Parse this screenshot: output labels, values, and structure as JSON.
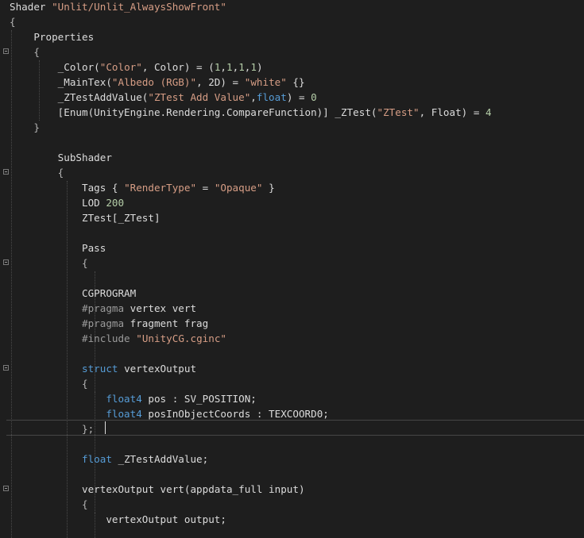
{
  "editor": {
    "theme_colors": {
      "background": "#1e1e1e",
      "default": "#dcdcdc",
      "string": "#d69d85",
      "keyword": "#569cd6",
      "number": "#b5cea8",
      "preprocessor": "#9b9b9b"
    },
    "lines": [
      [
        [
          "default",
          "Shader "
        ],
        [
          "string",
          "\"Unlit/Unlit_AlwaysShowFront\""
        ]
      ],
      [
        [
          "punct",
          "{"
        ]
      ],
      [
        [
          "default",
          "    Properties"
        ]
      ],
      [
        [
          "punct",
          "    {"
        ]
      ],
      [
        [
          "default",
          "        _Color("
        ],
        [
          "string",
          "\"Color\""
        ],
        [
          "default",
          ", Color) = ("
        ],
        [
          "number",
          "1"
        ],
        [
          "default",
          ","
        ],
        [
          "number",
          "1"
        ],
        [
          "default",
          ","
        ],
        [
          "number",
          "1"
        ],
        [
          "default",
          ","
        ],
        [
          "number",
          "1"
        ],
        [
          "default",
          ")"
        ]
      ],
      [
        [
          "default",
          "        _MainTex("
        ],
        [
          "string",
          "\"Albedo (RGB)\""
        ],
        [
          "default",
          ", 2D) = "
        ],
        [
          "string",
          "\"white\""
        ],
        [
          "default",
          " {}"
        ]
      ],
      [
        [
          "default",
          "        _ZTestAddValue("
        ],
        [
          "string",
          "\"ZTest Add Value\""
        ],
        [
          "default",
          ","
        ],
        [
          "keyword",
          "float"
        ],
        [
          "default",
          ") = "
        ],
        [
          "number",
          "0"
        ]
      ],
      [
        [
          "default",
          "        [Enum(UnityEngine.Rendering.CompareFunction)] _ZTest("
        ],
        [
          "string",
          "\"ZTest\""
        ],
        [
          "default",
          ", Float) = "
        ],
        [
          "number",
          "4"
        ]
      ],
      [
        [
          "punct",
          "    }"
        ]
      ],
      [
        [
          "default",
          ""
        ]
      ],
      [
        [
          "default",
          "        SubShader"
        ]
      ],
      [
        [
          "punct",
          "        {"
        ]
      ],
      [
        [
          "default",
          "            Tags { "
        ],
        [
          "string",
          "\"RenderType\""
        ],
        [
          "default",
          " = "
        ],
        [
          "string",
          "\"Opaque\""
        ],
        [
          "default",
          " }"
        ]
      ],
      [
        [
          "default",
          "            LOD "
        ],
        [
          "number",
          "200"
        ]
      ],
      [
        [
          "default",
          "            ZTest[_ZTest]"
        ]
      ],
      [
        [
          "default",
          ""
        ]
      ],
      [
        [
          "default",
          "            Pass"
        ]
      ],
      [
        [
          "punct",
          "            {"
        ]
      ],
      [
        [
          "default",
          ""
        ]
      ],
      [
        [
          "default",
          "            CGPROGRAM"
        ]
      ],
      [
        [
          "preproc",
          "            #pragma"
        ],
        [
          "default",
          " vertex vert"
        ]
      ],
      [
        [
          "preproc",
          "            #pragma"
        ],
        [
          "default",
          " fragment frag"
        ]
      ],
      [
        [
          "preproc",
          "            #include"
        ],
        [
          "default",
          " "
        ],
        [
          "string",
          "\"UnityCG.cginc\""
        ]
      ],
      [
        [
          "default",
          ""
        ]
      ],
      [
        [
          "keyword",
          "            struct"
        ],
        [
          "default",
          " vertexOutput"
        ]
      ],
      [
        [
          "punct",
          "            {"
        ]
      ],
      [
        [
          "keyword",
          "                float4"
        ],
        [
          "default",
          " pos : SV_POSITION;"
        ]
      ],
      [
        [
          "keyword",
          "                float4"
        ],
        [
          "default",
          " posInObjectCoords : TEXCOORD0;"
        ]
      ],
      [
        [
          "punct",
          "            };"
        ]
      ],
      [
        [
          "default",
          ""
        ]
      ],
      [
        [
          "keyword",
          "            float"
        ],
        [
          "default",
          " _ZTestAddValue;"
        ]
      ],
      [
        [
          "default",
          ""
        ]
      ],
      [
        [
          "default",
          "            vertexOutput vert(appdata_full input)"
        ]
      ],
      [
        [
          "punct",
          "            {"
        ]
      ],
      [
        [
          "default",
          "                vertexOutput output;"
        ]
      ],
      [
        [
          "default",
          ""
        ]
      ]
    ]
  }
}
